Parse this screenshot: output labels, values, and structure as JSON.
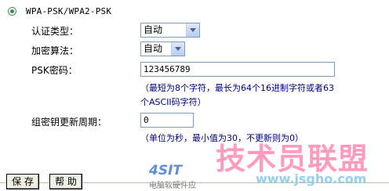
{
  "wpa": {
    "mode_label": "WPA-PSK/WPA2-PSK",
    "auth_type_label": "认证类型：",
    "auth_type_value": "自动",
    "encryption_label": "加密算法：",
    "encryption_value": "自动",
    "psk_label": "PSK密码：",
    "psk_value": "123456789",
    "psk_hint_line1": "（最短为8个字符，最长为64个16进制字符或者63",
    "psk_hint_line2": "个ASCII码字符）",
    "group_key_label": "组密钥更新周期：",
    "group_key_value": "0",
    "group_key_hint": "（单位为秒，最小值为30，不更新则为0）"
  },
  "footer": {
    "save_label": "保 存",
    "help_label": "帮 助"
  },
  "watermark": {
    "big_text": "技术员联盟",
    "url": "www.jsgho.com",
    "logo": "4SIT",
    "sub": "电脑软硬件应"
  },
  "colors": {
    "hint_text": "#000080",
    "radio_dot": "#2f9a2f",
    "watermark_pink": "#ff4a86"
  }
}
